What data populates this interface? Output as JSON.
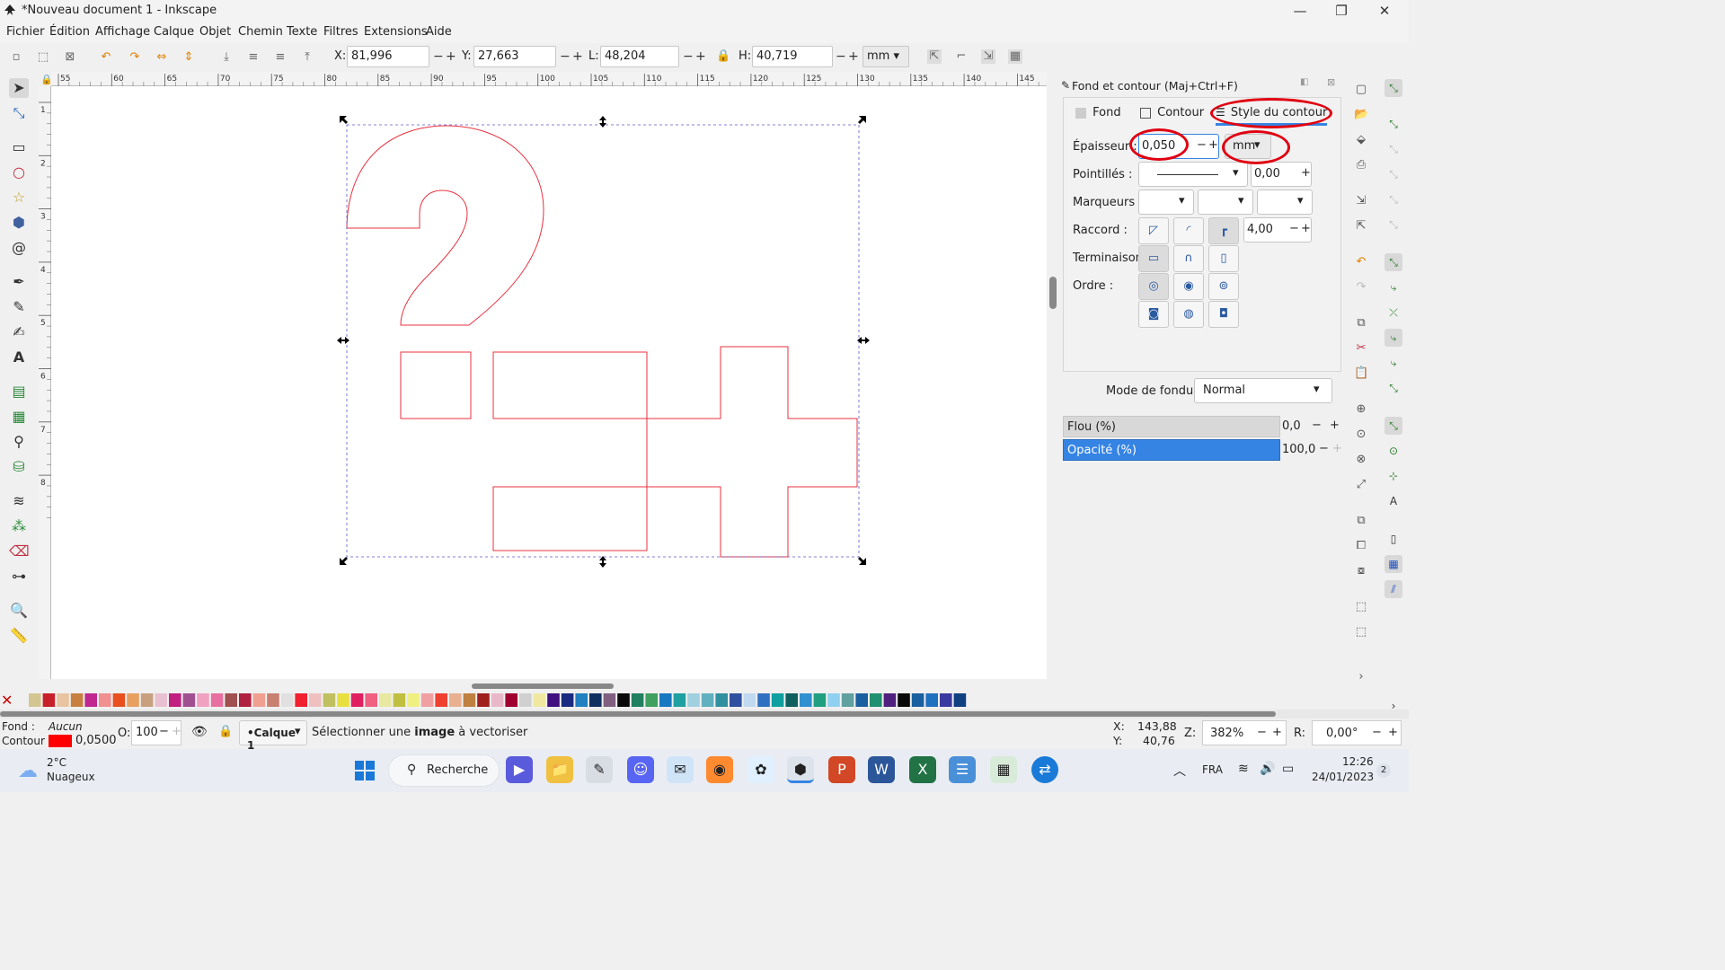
{
  "window": {
    "title": "*Nouveau document 1 - Inkscape",
    "minimize_glyph": "—",
    "restore_glyph": "❐",
    "close_glyph": "✕"
  },
  "menu": [
    "Fichier",
    "Édition",
    "Affichage",
    "Calque",
    "Objet",
    "Chemin",
    "Texte",
    "Filtres",
    "Extensions",
    "Aide"
  ],
  "toolbar": {
    "x_label": "X:",
    "x_value": "81,996",
    "y_label": "Y:",
    "y_value": "27,663",
    "w_label": "L:",
    "w_value": "48,204",
    "h_label": "H:",
    "h_value": "40,719",
    "unit": "mm",
    "minus": "−",
    "plus": "+"
  },
  "ruler_ticks": [
    "55",
    "60",
    "65",
    "70",
    "75",
    "80",
    "85",
    "90",
    "95",
    "100",
    "105",
    "110",
    "115",
    "120",
    "125",
    "130",
    "135",
    "140",
    "145"
  ],
  "ruler_left_ticks": [
    "1",
    "2",
    "3",
    "4",
    "5",
    "6",
    "7",
    "8"
  ],
  "dock": {
    "title": "Fond et contour (Maj+Ctrl+F)",
    "tabs": [
      "Fond",
      "Contour",
      "Style du contour"
    ],
    "thickness_label": "Épaisseur :",
    "thickness_value": "0,050",
    "thickness_unit": "mm",
    "dashes_label": "Pointillés :",
    "dash_offset": "0,00",
    "markers_label": "Marqueurs :",
    "join_label": "Raccord :",
    "miter_value": "4,00",
    "cap_label": "Terminaison :",
    "order_label": "Ordre :",
    "blend_label": "Mode de fondu :",
    "blend_value": "Normal",
    "blur_label": "Flou (%)",
    "blur_value": "0,0",
    "opacity_label": "Opacité (%)",
    "opacity_value": "100,0"
  },
  "status": {
    "fill_label": "Fond :",
    "fill_value": "Aucun",
    "stroke_label": "Contour :",
    "stroke_value": "0,0500",
    "o_label": "O:",
    "o_value": "100",
    "layer": "•Calque 1",
    "message_pre": "Sélectionner une ",
    "message_bold": "image",
    "message_post": " à vectoriser",
    "cursor_x_label": "X:",
    "cursor_x": "143,88",
    "cursor_y_label": "Y:",
    "cursor_y": "40,76",
    "zoom_label": "Z:",
    "zoom": "382%",
    "rotation_label": "R:",
    "rotation": "0,00°"
  },
  "taskbar": {
    "weather_temp": "2°C",
    "weather_desc": "Nuageux",
    "search": "Recherche",
    "language": "FRA",
    "time": "12:26",
    "date": "24/01/2023",
    "notifications": "2"
  },
  "colors": {
    "accent_blue": "#3584e4",
    "stroke_red": "#e8313f",
    "annotation_red": "#e00010",
    "selection_handle": "#000000"
  },
  "palette": [
    "#d4c690",
    "#c8202a",
    "#e8c4a0",
    "#c88040",
    "#c02890",
    "#f09090",
    "#e85020",
    "#e8a060",
    "#c8a080",
    "#e8c0d0",
    "#c02080",
    "#a05090",
    "#f0a0c0",
    "#e870a0",
    "#a05050",
    "#b02040",
    "#f0a090",
    "#c88070",
    "#e0e0e0",
    "#f02030",
    "#f0c0c0",
    "#c0c060",
    "#e8e040",
    "#e02060",
    "#f06080",
    "#e8e8a0",
    "#c0c040",
    "#f0f080",
    "#f0a0a0",
    "#f04030",
    "#e8b090",
    "#c08040",
    "#a02020",
    "#e8b8c8",
    "#a00030",
    "#d0d0d0",
    "#f0e8a0",
    "#401080",
    "#1a2a80",
    "#2080c0",
    "#103060",
    "#806080",
    "#0a0a0a",
    "#208060",
    "#40a060",
    "#1878c0",
    "#20a0a0",
    "#a0d0e0",
    "#60b0c0",
    "#3090a0",
    "#3050a0",
    "#c0d8f0",
    "#3070c0",
    "#10a0a0",
    "#106060",
    "#3090d0",
    "#20a080",
    "#90d0f0",
    "#60a0a0",
    "#1a60a0",
    "#209070",
    "#502080",
    "#0a0a0a",
    "#1a60a0",
    "#2070c0",
    "#3a3aa0",
    "#104080"
  ]
}
